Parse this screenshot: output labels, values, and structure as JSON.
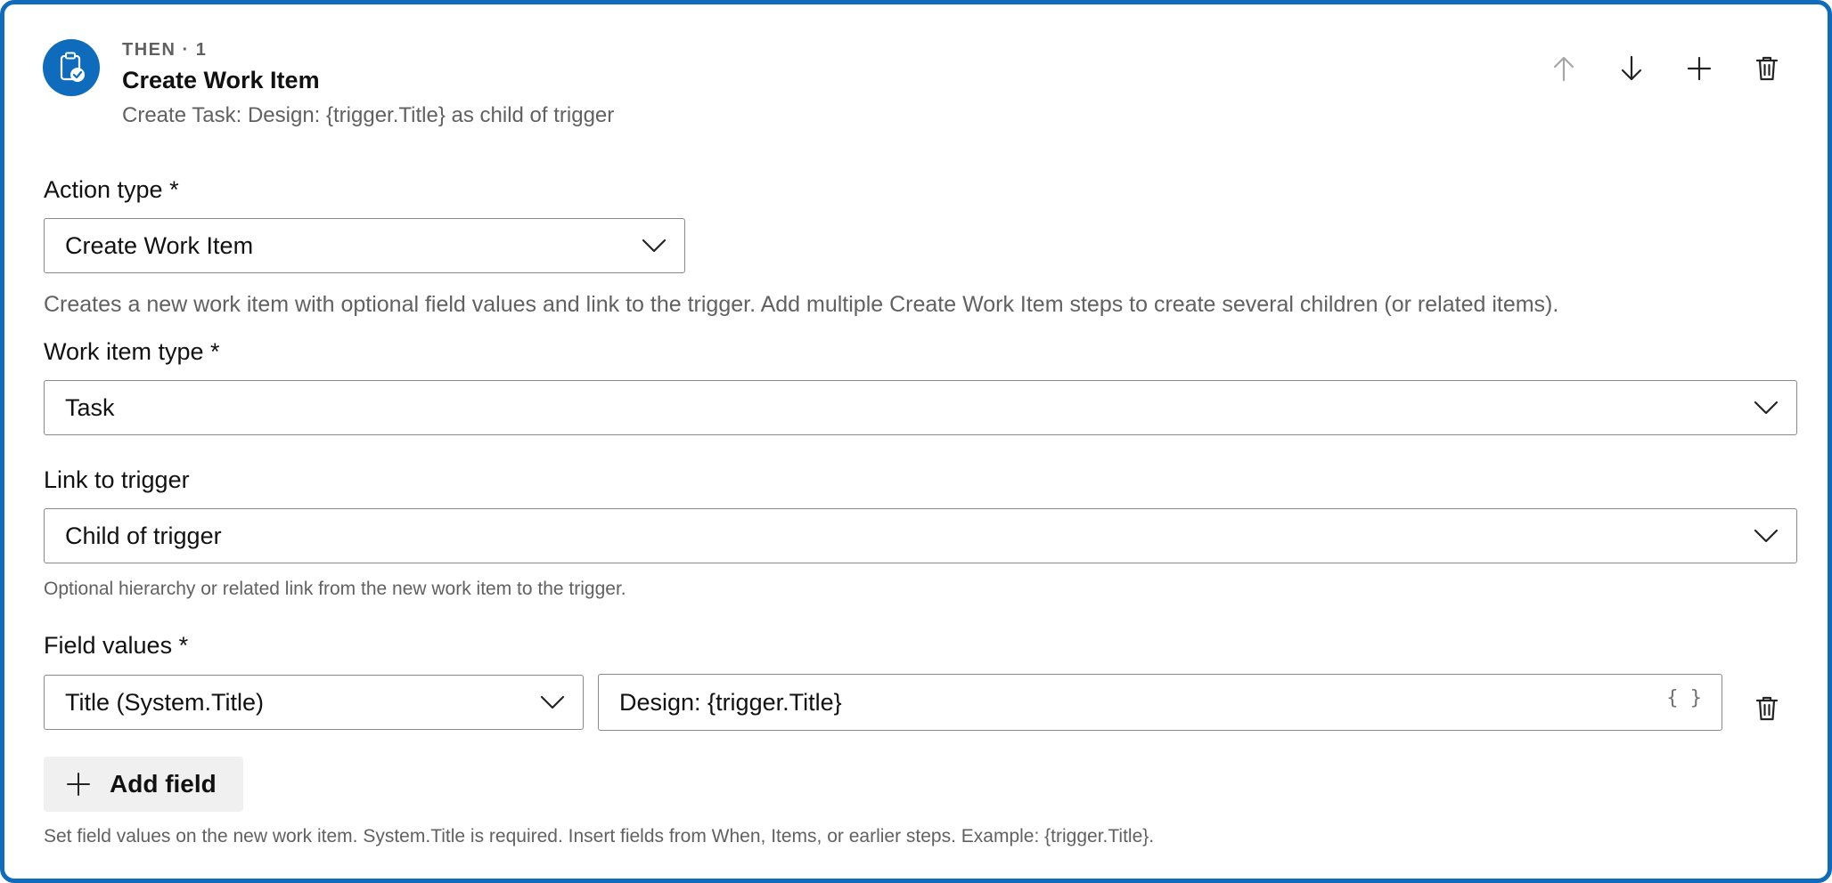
{
  "step": {
    "label": "THEN · 1",
    "title": "Create Work Item",
    "summary": "Create Task: Design: {trigger.Title} as child of trigger",
    "icon": "clipboard-check-icon",
    "accent_color": "#0f6cbd"
  },
  "toolbar": {
    "move_up": "arrow-up-icon",
    "move_down": "arrow-down-icon",
    "add": "plus-icon",
    "delete": "trash-icon"
  },
  "action_type": {
    "label": "Action type *",
    "value": "Create Work Item",
    "description": "Creates a new work item with optional field values and link to the trigger. Add multiple Create Work Item steps to create several children (or related items)."
  },
  "work_item_type": {
    "label": "Work item type *",
    "value": "Task"
  },
  "link_to_trigger": {
    "label": "Link to trigger",
    "value": "Child of trigger",
    "hint": "Optional hierarchy or related link from the new work item to the trigger."
  },
  "field_values": {
    "label": "Field values *",
    "rows": [
      {
        "field": "Title (System.Title)",
        "value": "Design: {trigger.Title}",
        "insert_token_label": "{ }"
      }
    ],
    "add_field_label": "Add field",
    "hint": "Set field values on the new work item. System.Title is required. Insert fields from When, Items, or earlier steps. Example: {trigger.Title}."
  }
}
